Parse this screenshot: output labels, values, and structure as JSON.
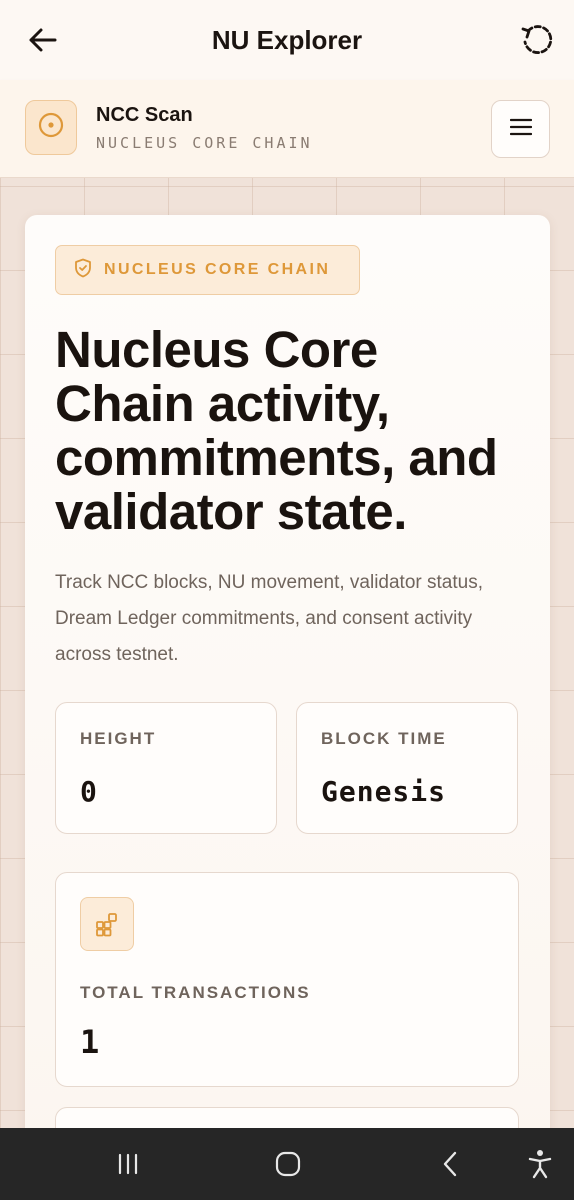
{
  "appbar": {
    "title": "NU Explorer",
    "back_icon": "arrow-left-icon",
    "reload_icon": "reload-icon"
  },
  "header": {
    "brand_name": "NCC Scan",
    "brand_subtitle": "NUCLEUS CORE CHAIN",
    "logo_icon": "target-circle-icon",
    "menu_icon": "hamburger-menu-icon"
  },
  "hero": {
    "tag_label": "NUCLEUS CORE CHAIN",
    "tag_icon": "shield-icon",
    "headline": "Nucleus Core Chain activity, commitments, and validator state.",
    "intro": "Track NCC blocks, NU movement, validator status, Dream Ledger commitments, and consent activity across testnet."
  },
  "stats": [
    {
      "label": "HEIGHT",
      "value": "0"
    },
    {
      "label": "BLOCK TIME",
      "value": "Genesis"
    }
  ],
  "transactions": {
    "label": "TOTAL TRANSACTIONS",
    "value": "1",
    "icon": "blocks-icon"
  },
  "colors": {
    "accent": "#de9839",
    "accent_bg": "#fcecd9",
    "text": "#1a130f",
    "muted": "#6f645c",
    "navbar": "#262626"
  },
  "system_nav": {
    "recents_icon": "recents-icon",
    "home_icon": "home-icon",
    "back_icon": "back-chevron-icon",
    "accessibility_icon": "accessibility-icon"
  }
}
